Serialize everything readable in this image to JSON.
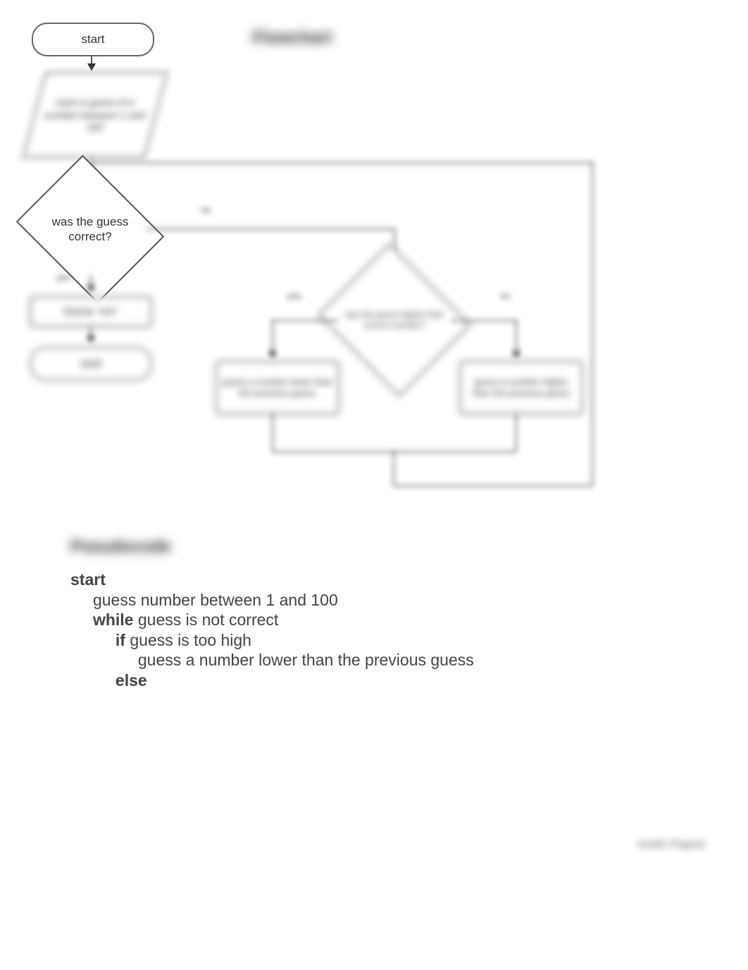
{
  "headings": {
    "flowchart": "Flowchart",
    "pseudocode": "Pseudocode"
  },
  "nodes": {
    "start": "start",
    "input": "input a guess of a number between 1 and 100",
    "decision1": "was the guess correct?",
    "decision1_yes": "yes",
    "decision1_no": "no",
    "process_win": "display \"win\"",
    "end": "end",
    "decision2": "was the guess higher than correct number?",
    "decision2_yes": "yes",
    "decision2_no": "no",
    "process_lower": "guess a number lower than the previous guess",
    "process_higher": "guess a number higher than the previous guess"
  },
  "pseudocode": {
    "l1_kw": "start",
    "l2": "guess number between 1 and 100",
    "l3_kw": "while ",
    "l3_rest": "guess is not correct",
    "l4_kw": "if ",
    "l4_rest": "guess is too high",
    "l5": "guess a number lower than the previous guess",
    "l6_kw": "else"
  },
  "footer": "Austin Pegues"
}
